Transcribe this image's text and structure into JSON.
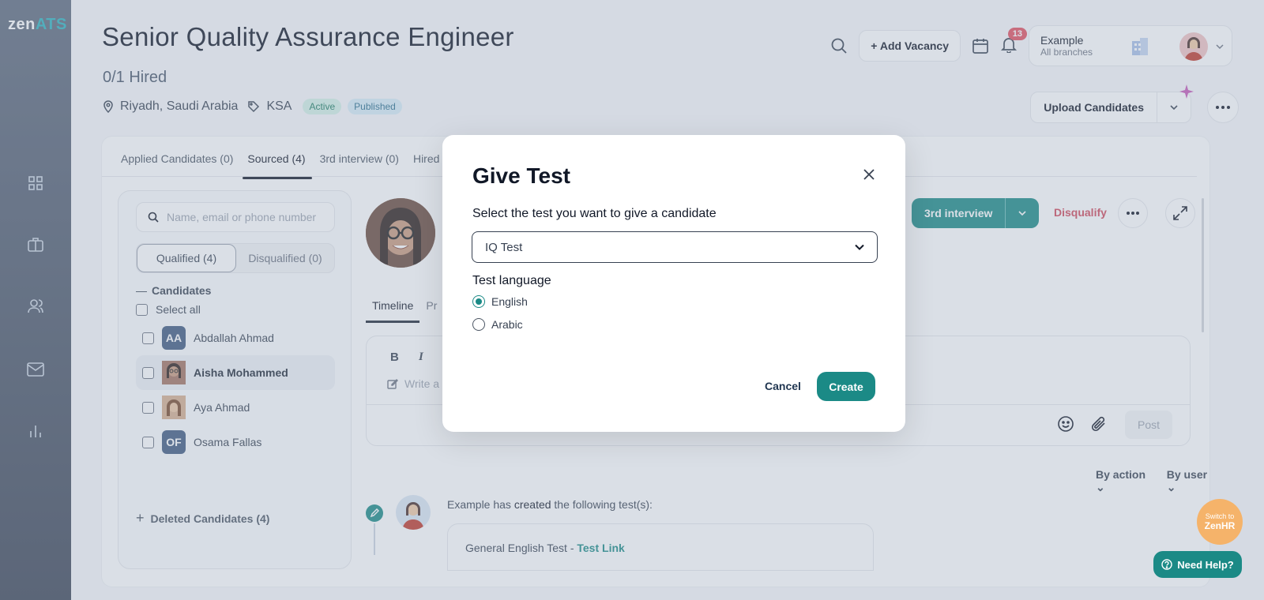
{
  "brand": {
    "logo_zen": "zen",
    "logo_ats": "ATS"
  },
  "sidebar": {
    "items": [
      "dashboard",
      "jobs",
      "candidates",
      "mail",
      "reports"
    ]
  },
  "header": {
    "job_title": "Senior Quality Assurance Engineer",
    "hired": "0/1 Hired",
    "location": "Riyadh, Saudi Arabia",
    "tag": "KSA",
    "status_active": "Active",
    "status_published": "Published",
    "add_vacancy": "+ Add Vacancy",
    "notifications_count": "13",
    "account_name": "Example",
    "account_sub": "All branches",
    "upload_candidates": "Upload Candidates"
  },
  "tabs": [
    {
      "label": "Applied Candidates (0)"
    },
    {
      "label": "Sourced (4)"
    },
    {
      "label": "3rd interview (0)"
    },
    {
      "label": "Hired"
    }
  ],
  "left_panel": {
    "search_placeholder": "Name, email or phone number",
    "seg_qualified": "Qualified (4)",
    "seg_disqualified": "Disqualified (0)",
    "candidates_heading": "Candidates",
    "select_all": "Select all",
    "candidates": [
      {
        "name": "Abdallah Ahmad",
        "initials": "AA"
      },
      {
        "name": "Aisha Mohammed",
        "initials": ""
      },
      {
        "name": "Aya Ahmad",
        "initials": ""
      },
      {
        "name": "Osama Fallas",
        "initials": "OF"
      }
    ],
    "deleted": "Deleted Candidates (4)"
  },
  "profile": {
    "stage_button": "3rd interview",
    "disqualify": "Disqualify",
    "subtab_timeline": "Timeline",
    "subtab_partial": "Pr",
    "editor_placeholder": "Write a",
    "post": "Post",
    "filter_action": "By action",
    "filter_user": "By user",
    "activity_actor": "Example",
    "activity_mid": " has ",
    "activity_verb": "created",
    "activity_rest": " the following test(s):",
    "card_test": "General English Test - ",
    "card_link": "Test Link"
  },
  "modal": {
    "title": "Give Test",
    "select_label": "Select the test you want to give a candidate",
    "selected_test": "IQ Test",
    "language_label": "Test language",
    "languages": [
      {
        "label": "English",
        "selected": true
      },
      {
        "label": "Arabic",
        "selected": false
      }
    ],
    "cancel": "Cancel",
    "create": "Create"
  },
  "floating": {
    "switch_small": "Switch to",
    "switch_big": "ZenHR",
    "need_help": "Need Help?"
  },
  "colors": {
    "accent": "#1b8a86",
    "danger": "#d1495b",
    "badge": "#e35060"
  }
}
